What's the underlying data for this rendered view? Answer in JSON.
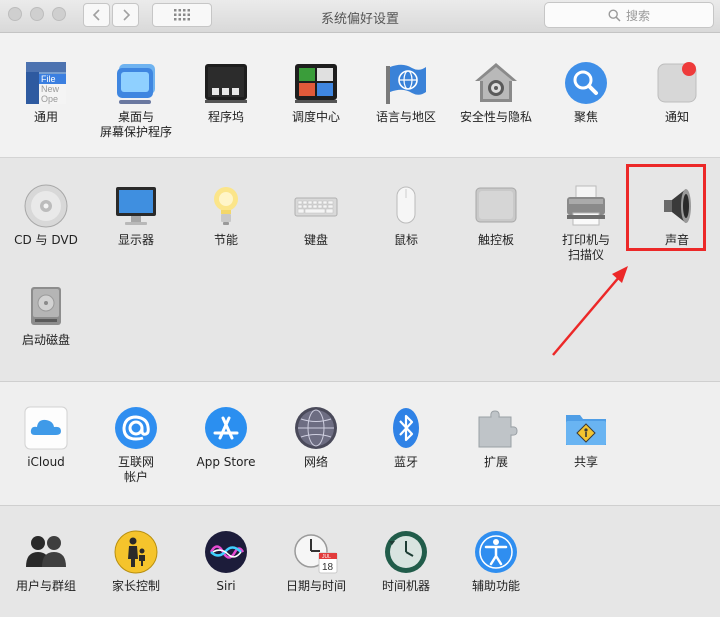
{
  "window": {
    "title": "系统偏好设置",
    "search_placeholder": "搜索"
  },
  "sections": [
    {
      "items": [
        {
          "label": "通用",
          "icon": "general-icon",
          "icon_text_1": "File",
          "icon_text_2": "New",
          "icon_text_3": "Ope"
        },
        {
          "label": "桌面与\n屏幕保护程序",
          "icon": "desktop-screensaver-icon"
        },
        {
          "label": "程序坞",
          "icon": "dock-icon"
        },
        {
          "label": "调度中心",
          "icon": "mission-control-icon"
        },
        {
          "label": "语言与地区",
          "icon": "language-region-icon"
        },
        {
          "label": "安全性与隐私",
          "icon": "security-privacy-icon"
        },
        {
          "label": "聚焦",
          "icon": "spotlight-icon"
        },
        {
          "label": "通知",
          "icon": "notifications-icon"
        }
      ]
    },
    {
      "items": [
        {
          "label": "CD 与 DVD",
          "icon": "cd-dvd-icon"
        },
        {
          "label": "显示器",
          "icon": "display-icon"
        },
        {
          "label": "节能",
          "icon": "energy-saver-icon"
        },
        {
          "label": "键盘",
          "icon": "keyboard-icon"
        },
        {
          "label": "鼠标",
          "icon": "mouse-icon"
        },
        {
          "label": "触控板",
          "icon": "trackpad-icon"
        },
        {
          "label": "打印机与\n扫描仪",
          "icon": "printer-scanner-icon"
        },
        {
          "label": "声音",
          "icon": "sound-icon",
          "highlighted": true
        },
        {
          "label": "启动磁盘",
          "icon": "startup-disk-icon"
        }
      ]
    },
    {
      "items": [
        {
          "label": "iCloud",
          "icon": "icloud-icon"
        },
        {
          "label": "互联网\n帐户",
          "icon": "internet-accounts-icon"
        },
        {
          "label": "App Store",
          "icon": "app-store-icon"
        },
        {
          "label": "网络",
          "icon": "network-icon"
        },
        {
          "label": "蓝牙",
          "icon": "bluetooth-icon"
        },
        {
          "label": "扩展",
          "icon": "extensions-icon"
        },
        {
          "label": "共享",
          "icon": "sharing-icon"
        }
      ]
    },
    {
      "items": [
        {
          "label": "用户与群组",
          "icon": "users-groups-icon"
        },
        {
          "label": "家长控制",
          "icon": "parental-controls-icon"
        },
        {
          "label": "Siri",
          "icon": "siri-icon"
        },
        {
          "label": "日期与时间",
          "icon": "date-time-icon",
          "icon_text_1": "JUL",
          "icon_text_2": "18"
        },
        {
          "label": "时间机器",
          "icon": "time-machine-icon"
        },
        {
          "label": "辅助功能",
          "icon": "accessibility-icon"
        }
      ]
    }
  ],
  "colors": {
    "highlight": "#ec2828",
    "accent_blue": "#2f8ef0"
  }
}
